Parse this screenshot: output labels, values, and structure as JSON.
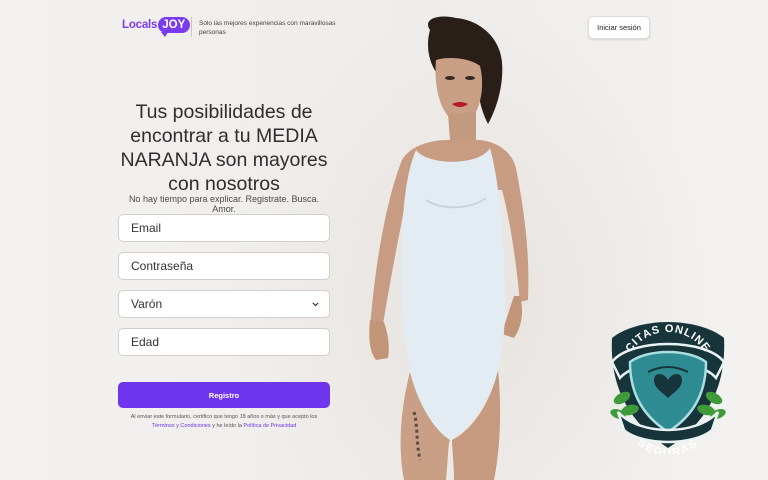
{
  "header": {
    "logo_part1": "Locals",
    "logo_part2": "JOY",
    "tagline": "Solo las mejores experiencias con maravillosas personas",
    "login_label": "Iniciar sesión"
  },
  "hero": {
    "headline": "Tus posibilidades de encontrar a tu MEDIA NARANJA son mayores con nosotros",
    "subhead": "No hay tiempo para explicar. Registrate. Busca. Amor."
  },
  "form": {
    "email_placeholder": "Email",
    "password_placeholder": "Contraseña",
    "gender_selected": "Varón",
    "age_placeholder": "Edad",
    "submit_label": "Registro",
    "legal_text": "Al enviar este formulario, certifico que tengo 18 años o más y que acepto los",
    "terms_link": "Términos y Condiciones",
    "legal_mid": " y he leído la ",
    "privacy_link": "Política de Privacidad"
  },
  "badge": {
    "top_text": "CITAS ONLINE",
    "bottom_text": "SEGURAS",
    "icon": "heart-shield-icon"
  },
  "colors": {
    "brand_purple": "#6e35ec",
    "badge_teal": "#2e8b91",
    "badge_dark": "#17343a",
    "leaf_green": "#3f9a3a"
  }
}
